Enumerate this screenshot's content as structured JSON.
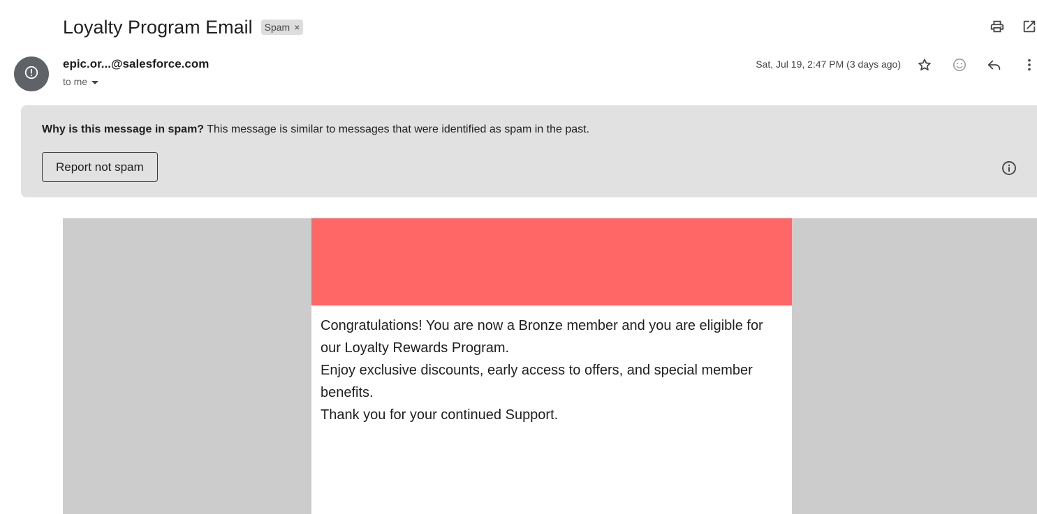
{
  "email": {
    "subject": "Loyalty Program Email",
    "label": "Spam",
    "label_remove": "×",
    "sender": "epic.or...@salesforce.com",
    "recipients": "to me",
    "date": "Sat, Jul 19, 2:47 PM (3 days ago)"
  },
  "spam_notice": {
    "heading": "Why is this message in spam?",
    "text": " This message is similar to messages that were identified as spam in the past.",
    "button": "Report not spam"
  },
  "body": {
    "banner_color": "#ff6666",
    "paragraphs": [
      "Congratulations! You are now a Bronze member and you are eligible for our Loyalty Rewards Program.",
      "Enjoy exclusive discounts, early access to offers, and special member benefits.",
      "Thank you for your continued Support."
    ]
  },
  "icons": {
    "print": "print-icon",
    "open_new_window": "open-in-new-icon",
    "avatar": "alert-icon",
    "star": "star-icon",
    "emoji": "emoji-icon",
    "reply": "reply-icon",
    "more": "more-vert-icon",
    "info": "info-icon"
  }
}
